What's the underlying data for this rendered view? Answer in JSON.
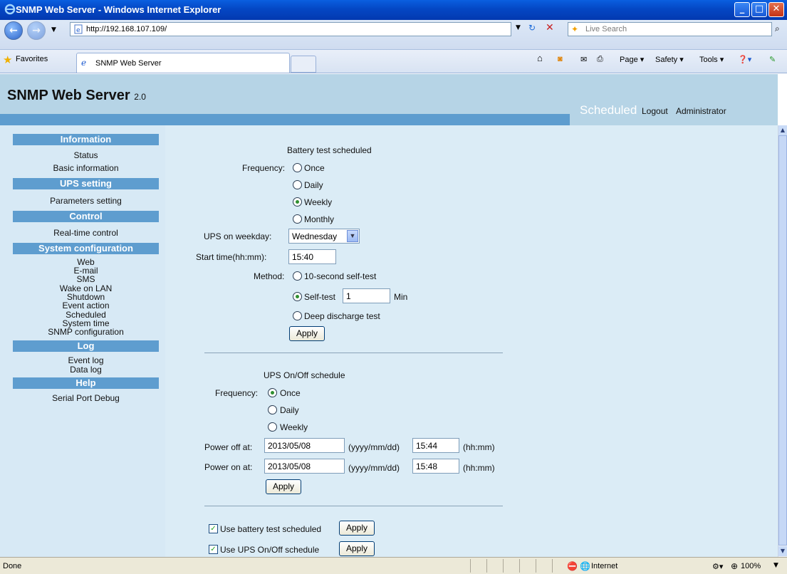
{
  "window": {
    "title": "SNMP Web Server - Windows Internet Explorer"
  },
  "browser": {
    "url": "http://192.168.107.109/",
    "search_placeholder": "Live Search",
    "favorites_label": "Favorites",
    "tab_title": "SNMP Web Server",
    "commands": {
      "page": "Page ▾",
      "safety": "Safety ▾",
      "tools": "Tools ▾"
    }
  },
  "header": {
    "brand": "SNMP Web Server",
    "version": "2.0",
    "current_page": "Scheduled",
    "logout": "Logout",
    "user": "Administrator"
  },
  "sidebar": {
    "information": {
      "title": "Information",
      "items": [
        "Status",
        "Basic information"
      ]
    },
    "ups_setting": {
      "title": "UPS setting",
      "items": [
        "Parameters setting"
      ]
    },
    "control": {
      "title": "Control",
      "items": [
        "Real-time control"
      ]
    },
    "system_configuration": {
      "title": "System configuration",
      "items": [
        "Web",
        "E-mail",
        "SMS",
        "Wake on LAN",
        "Shutdown",
        "Event action",
        "Scheduled",
        "System time",
        "SNMP configuration"
      ]
    },
    "log": {
      "title": "Log",
      "items": [
        "Event log",
        "Data log"
      ]
    },
    "help": {
      "title": "Help",
      "items": [
        "Serial Port Debug"
      ]
    }
  },
  "battery_test": {
    "heading": "Battery test scheduled",
    "frequency_label": "Frequency:",
    "frequency_options": [
      "Once",
      "Daily",
      "Weekly",
      "Monthly"
    ],
    "frequency_selected": "Weekly",
    "weekday_label": "UPS on weekday:",
    "weekday_value": "Wednesday",
    "start_time_label": "Start time(hh:mm):",
    "start_time_value": "15:40",
    "method_label": "Method:",
    "method_options": [
      "10-second self-test",
      "Self-test",
      "Deep discharge test"
    ],
    "method_selected": "Self-test",
    "self_test_minutes": "1",
    "self_test_unit": "Min",
    "apply_label": "Apply"
  },
  "onoff_schedule": {
    "heading": "UPS On/Off schedule",
    "frequency_label": "Frequency:",
    "frequency_options": [
      "Once",
      "Daily",
      "Weekly"
    ],
    "frequency_selected": "Once",
    "power_off_label": "Power off at:",
    "power_off_date": "2013/05/08",
    "power_off_time": "15:44",
    "power_on_label": "Power on at:",
    "power_on_date": "2013/05/08",
    "power_on_time": "15:48",
    "date_format": "(yyyy/mm/dd)",
    "time_format": "(hh:mm)",
    "apply_label": "Apply"
  },
  "enable": {
    "use_battery_test_label": "Use battery test scheduled",
    "use_battery_test_checked": true,
    "use_onoff_label": "Use UPS On/Off schedule",
    "use_onoff_checked": true,
    "apply_label": "Apply"
  },
  "status_bar": {
    "text": "Done",
    "zone": "Internet",
    "zoom": "100%"
  }
}
